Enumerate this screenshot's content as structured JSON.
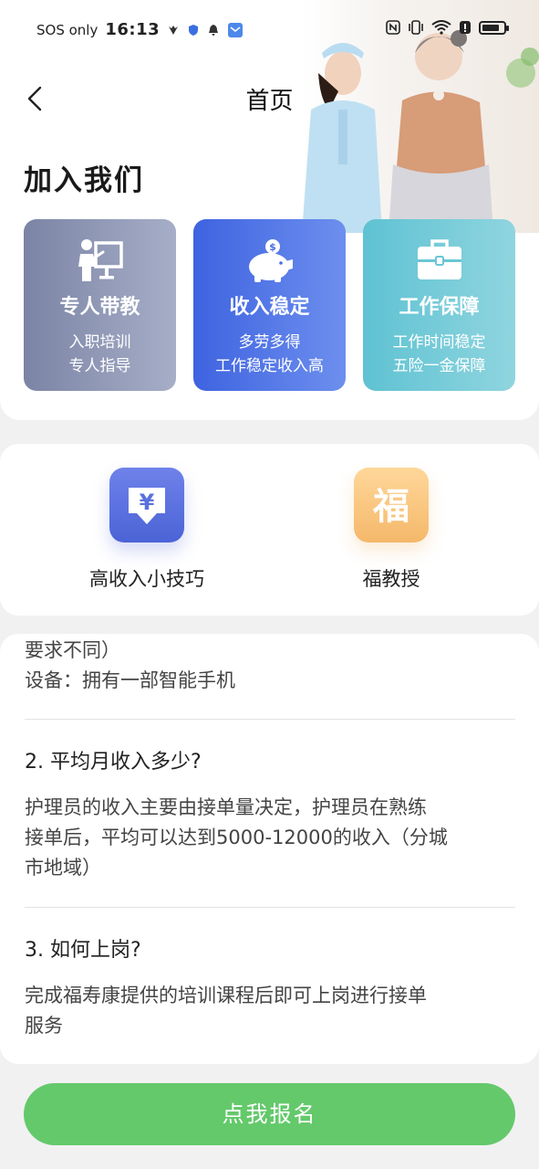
{
  "status_bar": {
    "carrier": "SOS only",
    "time": "16:13",
    "battery_level": 0.8
  },
  "header": {
    "title": "首页"
  },
  "join": {
    "heading": "加入我们",
    "cards": [
      {
        "title": "专人带教",
        "line1": "入职培训",
        "line2": "专人指导",
        "icon": "teacher-icon"
      },
      {
        "title": "收入稳定",
        "line1": "多劳多得",
        "line2": "工作稳定收入高",
        "icon": "piggy-bank-icon"
      },
      {
        "title": "工作保障",
        "line1": "工作时间稳定",
        "line2": "五险一金保障",
        "icon": "briefcase-icon"
      }
    ]
  },
  "features": [
    {
      "label": "高收入小技巧",
      "icon": "yen-download-icon",
      "glyph": "¥"
    },
    {
      "label": "福教授",
      "icon": "fu-character-icon",
      "glyph": "福"
    }
  ],
  "faq": {
    "partial_line1": "要求不同）",
    "partial_line2": "设备：拥有一部智能手机",
    "q2": "2. 平均月收入多少?",
    "a2_line1": "护理员的收入主要由接单量决定，护理员在熟练",
    "a2_line2": "接单后，平均可以达到5000-12000的收入（分城",
    "a2_line3": "市地域）",
    "q3": "3. 如何上岗?",
    "a3_line1": "完成福寿康提供的培训课程后即可上岗进行接单",
    "a3_line2": "服务"
  },
  "signup": {
    "label": "点我报名"
  },
  "colors": {
    "primary_green": "#64c96b",
    "card_gray": "#7b84a4",
    "card_blue": "#3e63e0",
    "card_teal": "#5fc2d2"
  }
}
